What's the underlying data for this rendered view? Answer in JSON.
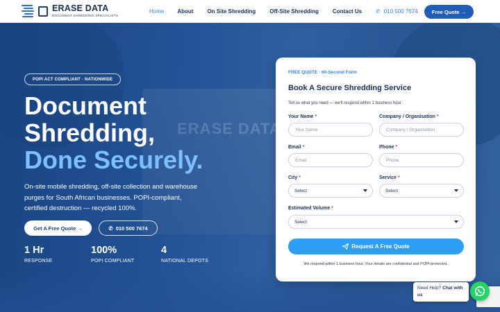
{
  "brand": {
    "name": "ERASE DATA",
    "tagline": "DOCUMENT SHREDDING SPECIALISTS"
  },
  "nav": {
    "items": [
      {
        "label": "Home",
        "active": true
      },
      {
        "label": "About",
        "active": false
      },
      {
        "label": "On Site Shredding",
        "active": false
      },
      {
        "label": "Off-Site Shredding",
        "active": false
      },
      {
        "label": "Contact Us",
        "active": false
      }
    ],
    "phone": "010 500 7674",
    "quote_label": "Free Quote →"
  },
  "hero": {
    "badge": "POPI ACT COMPLIANT · NATIONWIDE",
    "headline_line1": "Document",
    "headline_line2": "Shredding,",
    "headline_line3": "Done Securely.",
    "lead": "On-site mobile shredding, off-site collection and warehouse purges for South African businesses. POPI-compliant, certified destruction — recycled 100%.",
    "cta_primary": "Get A Free Quote →",
    "cta_secondary": "010 500 7674",
    "stats": [
      {
        "value": "1 Hr",
        "label": "RESPONSE"
      },
      {
        "value": "100%",
        "label": "POPI COMPLIANT"
      },
      {
        "value": "4",
        "label": "NATIONAL DEPOTS"
      }
    ]
  },
  "form": {
    "kicker": "FREE QUOTE · 60-Second Form",
    "title": "Book A Secure Shredding Service",
    "description": "Tell us what you need — we'll respond within 1 business hour.",
    "fields": {
      "name": {
        "label": "Your Name",
        "placeholder": "Your Name"
      },
      "company": {
        "label": "Company / Organisation",
        "placeholder": "Company / Organisation"
      },
      "email": {
        "label": "Email",
        "placeholder": "Email"
      },
      "phone": {
        "label": "Phone",
        "placeholder": "Phone"
      },
      "city": {
        "label": "City",
        "value": "Select"
      },
      "service": {
        "label": "Service",
        "value": "Select"
      },
      "volume": {
        "label": "Estimated Volume",
        "value": "Select"
      }
    },
    "required_mark": "*",
    "submit_label": "Request A Free Quote",
    "fine_print": "We respond within 1 business hour. Your details are confidential and POPI-protected."
  },
  "chat": {
    "prompt": "Need Help?",
    "action": "Chat with us"
  },
  "colors": {
    "brand_navy": "#1b2f57",
    "accent_blue": "#2f82f0",
    "cta_blue": "#2f9ff5",
    "whatsapp_green": "#25d366"
  }
}
